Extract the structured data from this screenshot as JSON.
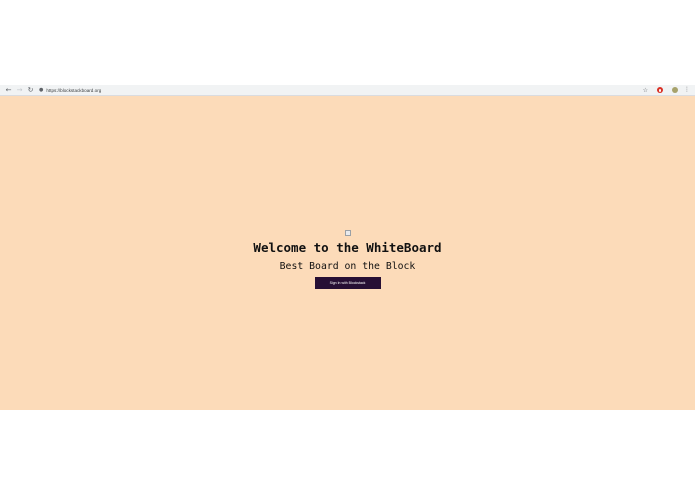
{
  "browser": {
    "url": "https://blockstackboard.org",
    "icons": {
      "back": "back-arrow-icon",
      "forward": "forward-arrow-icon",
      "reload": "reload-icon",
      "lock": "lock-icon",
      "bookmark": "star-icon",
      "extension": "opera-extension-icon",
      "profile": "profile-avatar-icon",
      "menu": "kebab-menu-icon"
    }
  },
  "page": {
    "background": "#fcdbb9",
    "title": "Welcome to the WhiteBoard",
    "subtitle": "Best Board on the Block",
    "signin_label": "Sign In with Blockstack",
    "button_color": "#270f34"
  }
}
